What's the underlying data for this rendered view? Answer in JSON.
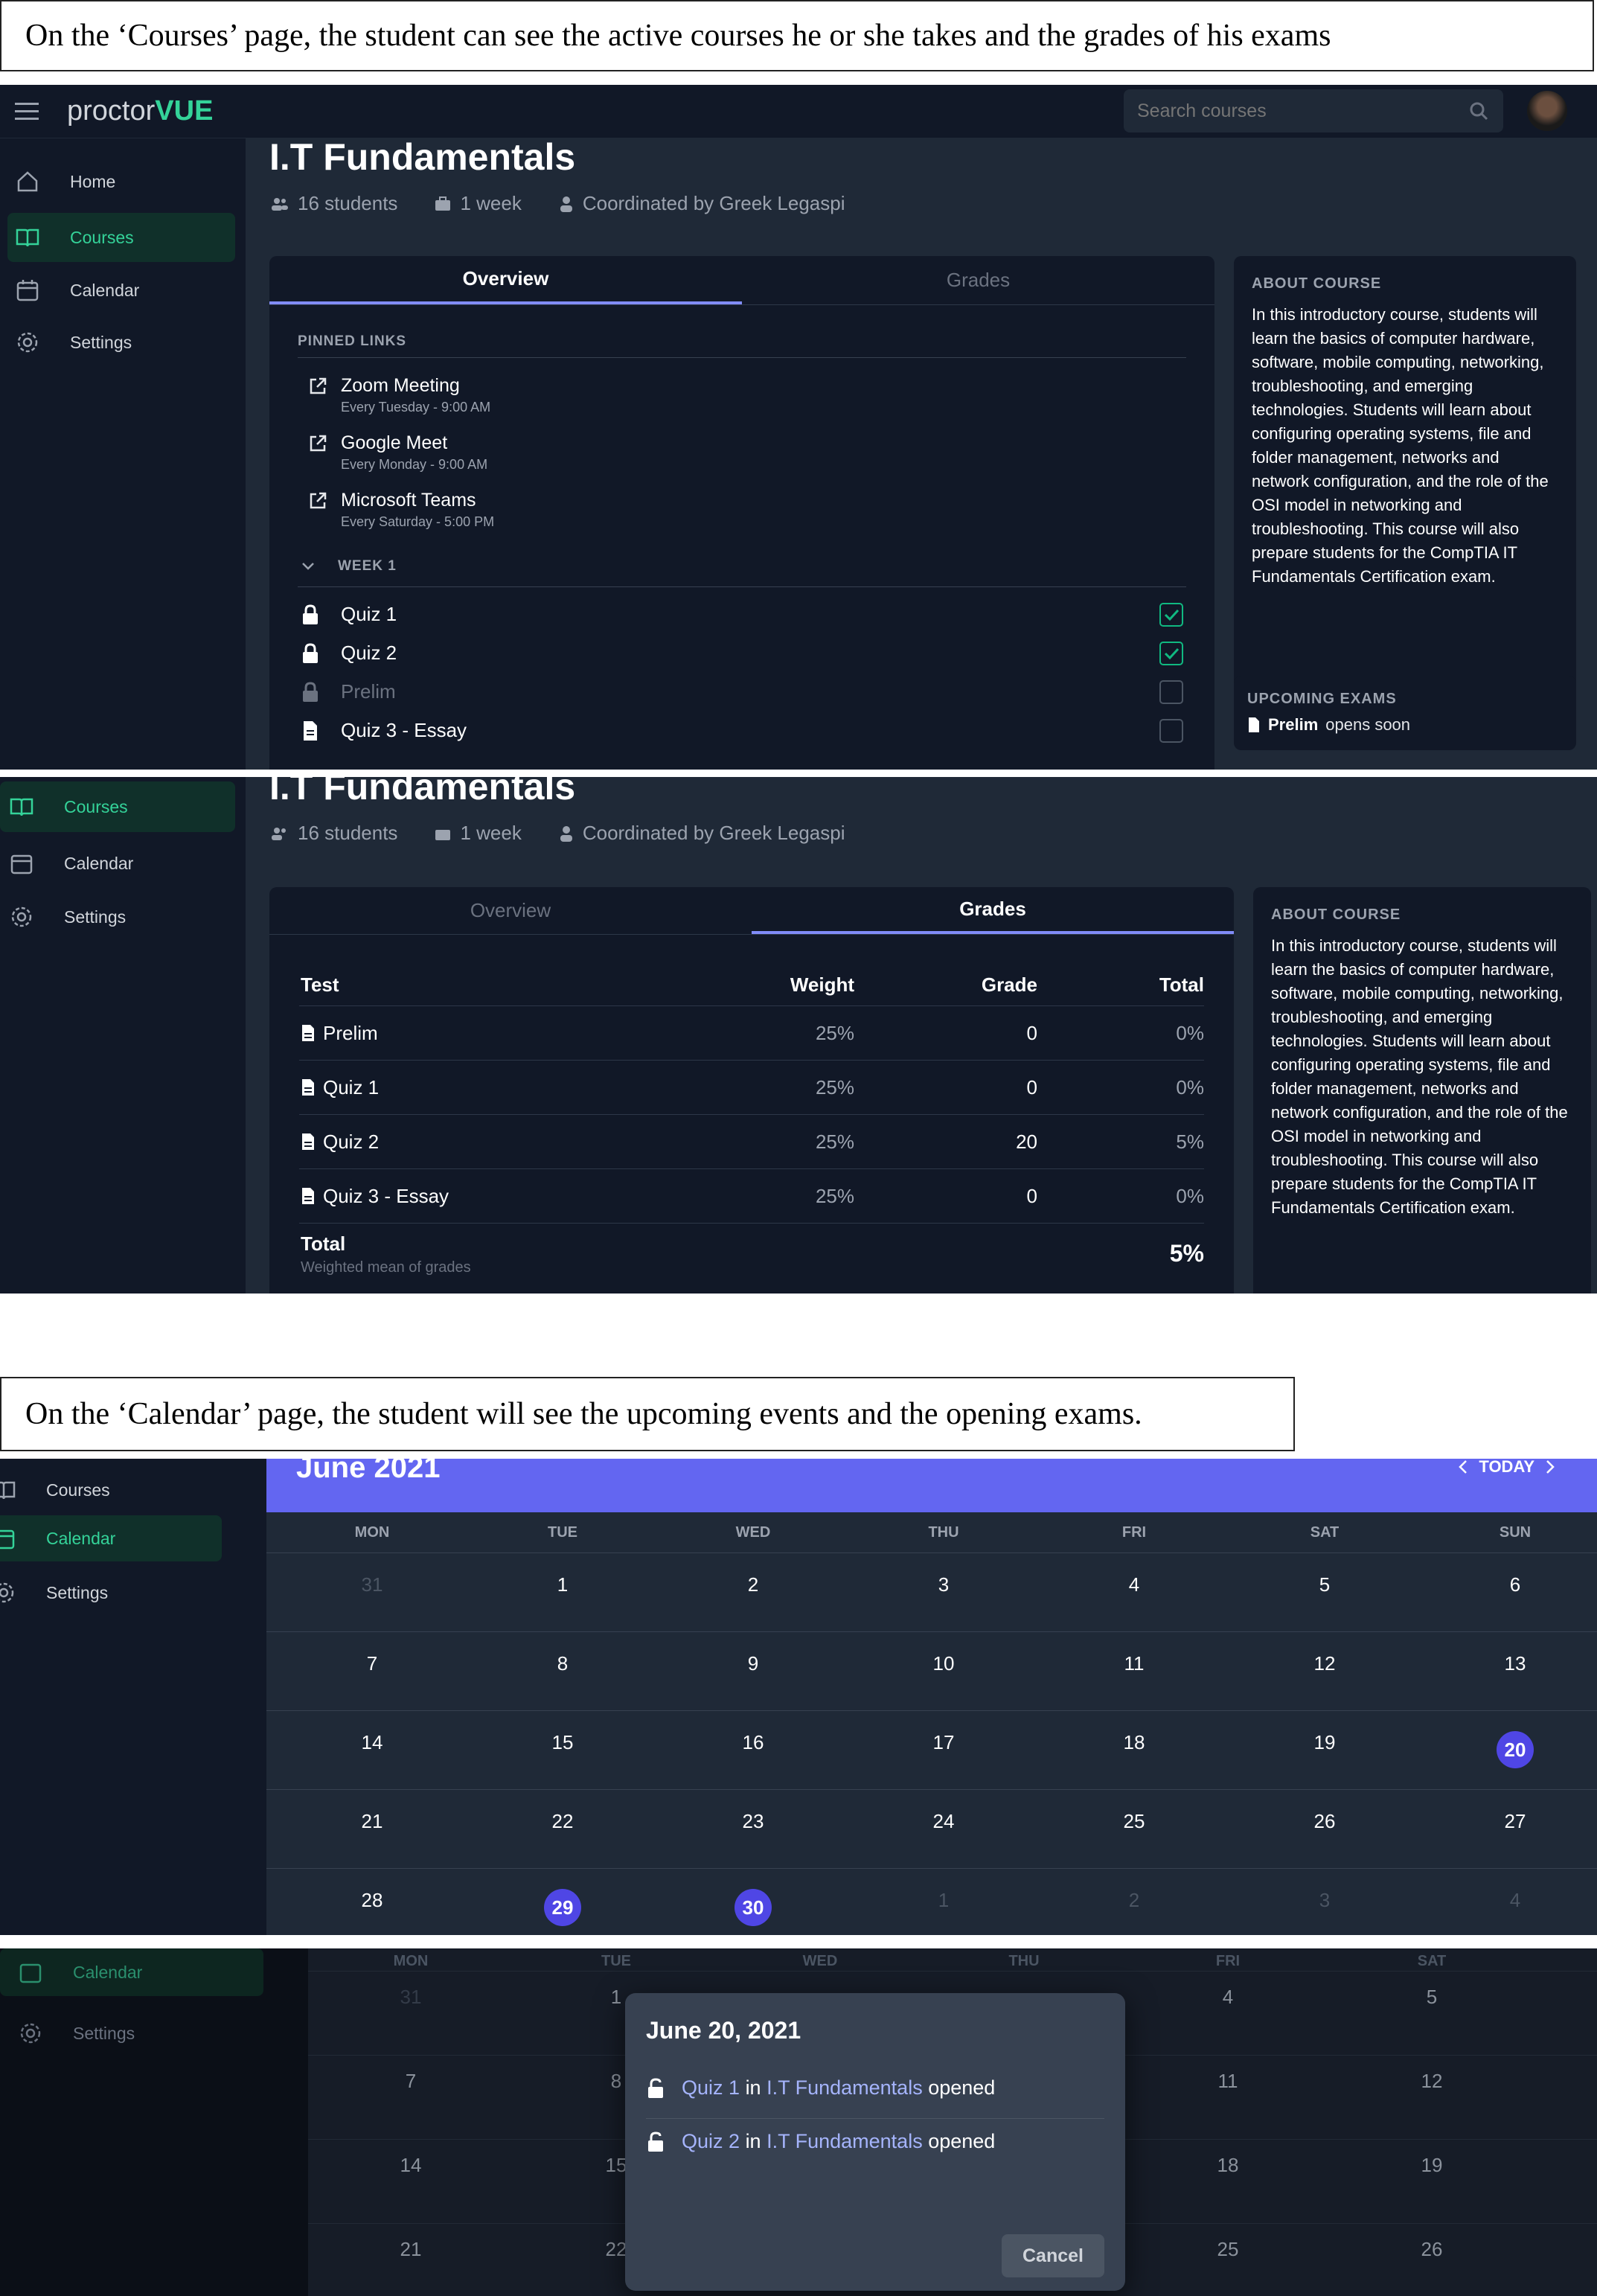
{
  "captions": {
    "courses": "On the ‘Courses’ page, the student can see the active courses he or she takes and the grades of his exams",
    "calendar": "On the ‘Calendar’ page, the student will see the upcoming events and the opening exams."
  },
  "app": {
    "logo_left": "proctor",
    "logo_right": "VUE",
    "search_placeholder": "Search courses",
    "accent": "#34d399",
    "highlight": "#6366f1"
  },
  "nav": {
    "home": "Home",
    "courses": "Courses",
    "calendar": "Calendar",
    "settings": "Settings"
  },
  "course": {
    "title": "I.T Fundamentals",
    "students": "16 students",
    "duration": "1 week",
    "coordinator": "Coordinated by Greek Legaspi",
    "tab_overview": "Overview",
    "tab_grades": "Grades",
    "pinned_label": "PINNED LINKS",
    "links": [
      {
        "name": "Zoom Meeting",
        "schedule": "Every Tuesday - 9:00 AM"
      },
      {
        "name": "Google Meet",
        "schedule": "Every Monday - 9:00 AM"
      },
      {
        "name": "Microsoft Teams",
        "schedule": "Every Saturday - 5:00 PM"
      }
    ],
    "week_label": "WEEK 1",
    "items": [
      {
        "name": "Quiz 1",
        "done": true
      },
      {
        "name": "Quiz 2",
        "done": true
      },
      {
        "name": "Prelim",
        "done": false
      },
      {
        "name": "Quiz 3 - Essay",
        "done": false
      }
    ],
    "about_label": "ABOUT COURSE",
    "about_text": "In this introductory course, students will learn the basics of computer hardware, software, mobile computing, networking, troubleshooting, and emerging technologies. Students will learn about configuring operating systems, file and folder management, networks and network configuration, and the role of the OSI model in networking and troubleshooting. This course will also prepare students for the CompTIA IT Fundamentals Certification exam.",
    "upcoming_label": "UPCOMING EXAMS",
    "upcoming_bold": "Prelim",
    "upcoming_rest": "opens soon"
  },
  "grades": {
    "headers": {
      "test": "Test",
      "weight": "Weight",
      "grade": "Grade",
      "total": "Total"
    },
    "rows": [
      {
        "test": "Prelim",
        "weight": "25%",
        "grade": "0",
        "total": "0%"
      },
      {
        "test": "Quiz 1",
        "weight": "25%",
        "grade": "0",
        "total": "0%"
      },
      {
        "test": "Quiz 2",
        "weight": "25%",
        "grade": "20",
        "total": "5%"
      },
      {
        "test": "Quiz 3 - Essay",
        "weight": "25%",
        "grade": "0",
        "total": "0%"
      }
    ],
    "total_label": "Total",
    "total_sub": "Weighted mean of grades",
    "total_value": "5%"
  },
  "calendar": {
    "month": "June 2021",
    "today": "TODAY",
    "days_of_week": [
      "MON",
      "TUE",
      "WED",
      "THU",
      "FRI",
      "SAT",
      "SUN"
    ],
    "weeks": [
      [
        "31",
        "1",
        "2",
        "3",
        "4",
        "5",
        "6"
      ],
      [
        "7",
        "8",
        "9",
        "10",
        "11",
        "12",
        "13"
      ],
      [
        "14",
        "15",
        "16",
        "17",
        "18",
        "19",
        "20"
      ],
      [
        "21",
        "22",
        "23",
        "24",
        "25",
        "26",
        "27"
      ],
      [
        "28",
        "29",
        "30",
        "1",
        "2",
        "3",
        "4"
      ]
    ]
  },
  "modal": {
    "date": "June 20, 2021",
    "events": [
      {
        "exam": "Quiz 1",
        "in": "in",
        "course": "I.T Fundamentals",
        "status": "opened"
      },
      {
        "exam": "Quiz 2",
        "in": "in",
        "course": "I.T Fundamentals",
        "status": "opened"
      }
    ],
    "cancel": "Cancel",
    "partial_days": [
      "1",
      "4",
      "5",
      "8",
      "11",
      "12",
      "15",
      "18",
      "19",
      "22",
      "25",
      "26"
    ]
  }
}
